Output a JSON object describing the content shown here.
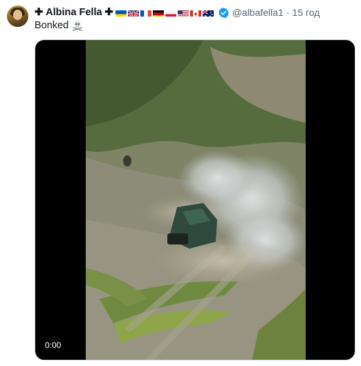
{
  "author": {
    "cross_left": "✚",
    "name": "Albina Fella",
    "cross_right": "✚",
    "flags": [
      "ukraine",
      "united-kingdom",
      "france",
      "germany",
      "poland",
      "united-states",
      "canada",
      "australia"
    ],
    "handle": "@albafella1",
    "separator": "·",
    "time": "15 год"
  },
  "tweet": {
    "text": "Bonked"
  },
  "video": {
    "timestamp": "0:00"
  },
  "colors": {
    "verified": "#1d9bf0",
    "secondary_text": "#536471",
    "primary_text": "#0f1419"
  }
}
